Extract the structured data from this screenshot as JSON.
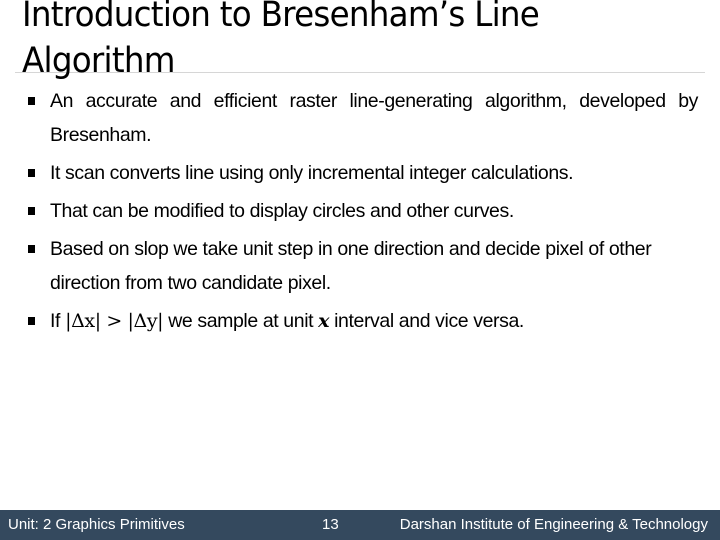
{
  "slide": {
    "title": "Introduction to Bresenham’s Line Algorithm",
    "bullets": [
      {
        "text": "An accurate and efficient raster line-generating algorithm, developed by Bresenham."
      },
      {
        "text": "It scan converts line using only incremental integer calculations."
      },
      {
        "text": "That can be modified to display circles and other curves."
      },
      {
        "text": "Based on slop we take unit step in one direction and decide pixel of other direction from two candidate pixel."
      },
      {
        "prefix": "If ",
        "math_left": "|Δx|",
        "math_op": " > ",
        "math_right": "|Δy|",
        "middle": " we sample at unit ",
        "math_var": "x",
        "suffix": " interval and vice versa."
      }
    ]
  },
  "footer": {
    "unit": "Unit: 2 Graphics Primitives",
    "page_number": "13",
    "institute": "Darshan Institute of Engineering & Technology",
    "background_color": "#34495e"
  }
}
